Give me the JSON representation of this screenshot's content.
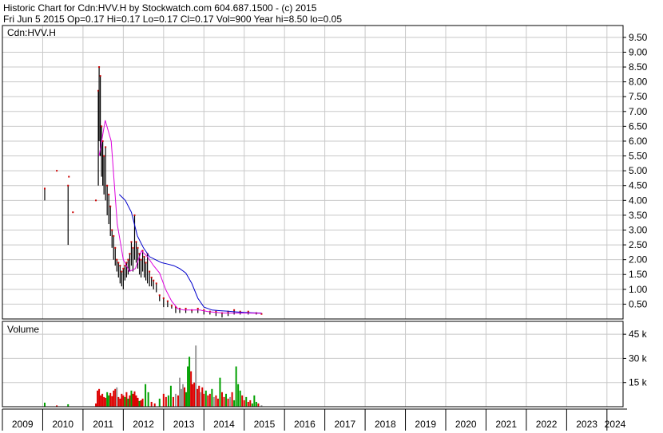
{
  "header": {
    "line1": "Historic Chart for Cdn:HVV.H by Stockwatch.com 604.687.1500 - (c) 2015",
    "line2": "Fri Jun  5 2015  Op=0.17  Hi=0.17  Lo=0.17  Cl=0.17  Vol=900  Year hi=8.50  lo=0.05"
  },
  "chart_data": [
    {
      "type": "line",
      "title": "Cdn:HVV.H",
      "xlim": [
        2009.0,
        2024.4
      ],
      "ylim": [
        0,
        9.9
      ],
      "y_ticks": [
        0.5,
        1.0,
        1.5,
        2.0,
        2.5,
        3.0,
        3.5,
        4.0,
        4.5,
        5.0,
        5.5,
        6.0,
        6.5,
        7.0,
        7.5,
        8.0,
        8.5,
        9.0,
        9.5
      ],
      "y_tick_labels": [
        "0.50",
        "1.00",
        "1.50",
        "2.00",
        "2.50",
        "3.00",
        "3.50",
        "4.00",
        "4.50",
        "5.00",
        "5.50",
        "6.00",
        "6.50",
        "7.00",
        "7.50",
        "8.00",
        "8.50",
        "9.00",
        "9.50"
      ],
      "grid": true,
      "colors": {
        "price": "#000000",
        "close": "#cc0000",
        "ma_short": "#dd00dd",
        "ma_long": "#0000cc"
      },
      "price_bars": [
        {
          "x": 2010.05,
          "hi": 4.4,
          "lo": 4.0
        },
        {
          "x": 2010.35,
          "hi": 5.0,
          "lo": 5.0
        },
        {
          "x": 2010.65,
          "hi": 4.8,
          "lo": 4.8
        },
        {
          "x": 2010.63,
          "hi": 4.5,
          "lo": 2.5
        },
        {
          "x": 2010.75,
          "hi": 3.6,
          "lo": 3.6
        },
        {
          "x": 2011.32,
          "hi": 4.0,
          "lo": 4.0
        },
        {
          "x": 2011.38,
          "hi": 7.7,
          "lo": 4.5
        },
        {
          "x": 2011.4,
          "hi": 8.5,
          "lo": 6.0
        },
        {
          "x": 2011.43,
          "hi": 8.2,
          "lo": 5.5
        },
        {
          "x": 2011.46,
          "hi": 6.5,
          "lo": 4.8
        },
        {
          "x": 2011.49,
          "hi": 6.0,
          "lo": 4.5
        },
        {
          "x": 2011.52,
          "hi": 5.5,
          "lo": 4.2
        },
        {
          "x": 2011.56,
          "hi": 5.8,
          "lo": 4.0
        },
        {
          "x": 2011.6,
          "hi": 4.5,
          "lo": 3.5
        },
        {
          "x": 2011.64,
          "hi": 4.2,
          "lo": 3.2
        },
        {
          "x": 2011.68,
          "hi": 3.8,
          "lo": 2.8
        },
        {
          "x": 2011.72,
          "hi": 3.0,
          "lo": 2.4
        },
        {
          "x": 2011.76,
          "hi": 2.8,
          "lo": 2.0
        },
        {
          "x": 2011.8,
          "hi": 2.4,
          "lo": 1.8
        },
        {
          "x": 2011.84,
          "hi": 2.0,
          "lo": 1.6
        },
        {
          "x": 2011.88,
          "hi": 1.9,
          "lo": 1.4
        },
        {
          "x": 2011.92,
          "hi": 1.8,
          "lo": 1.2
        },
        {
          "x": 2011.96,
          "hi": 1.6,
          "lo": 1.1
        },
        {
          "x": 2012.0,
          "hi": 1.7,
          "lo": 1.0
        },
        {
          "x": 2012.04,
          "hi": 1.8,
          "lo": 1.3
        },
        {
          "x": 2012.08,
          "hi": 1.9,
          "lo": 1.4
        },
        {
          "x": 2012.12,
          "hi": 2.0,
          "lo": 1.5
        },
        {
          "x": 2012.16,
          "hi": 2.2,
          "lo": 1.6
        },
        {
          "x": 2012.2,
          "hi": 2.6,
          "lo": 1.8
        },
        {
          "x": 2012.24,
          "hi": 2.4,
          "lo": 1.6
        },
        {
          "x": 2012.28,
          "hi": 3.5,
          "lo": 2.0
        },
        {
          "x": 2012.32,
          "hi": 2.6,
          "lo": 1.9
        },
        {
          "x": 2012.36,
          "hi": 2.4,
          "lo": 1.7
        },
        {
          "x": 2012.4,
          "hi": 2.2,
          "lo": 1.5
        },
        {
          "x": 2012.44,
          "hi": 2.0,
          "lo": 1.4
        },
        {
          "x": 2012.48,
          "hi": 2.3,
          "lo": 1.6
        },
        {
          "x": 2012.52,
          "hi": 2.1,
          "lo": 1.4
        },
        {
          "x": 2012.56,
          "hi": 1.9,
          "lo": 1.3
        },
        {
          "x": 2012.6,
          "hi": 2.2,
          "lo": 1.2
        },
        {
          "x": 2012.65,
          "hi": 1.6,
          "lo": 1.1
        },
        {
          "x": 2012.7,
          "hi": 1.4,
          "lo": 1.1
        },
        {
          "x": 2012.75,
          "hi": 1.3,
          "lo": 1.0
        },
        {
          "x": 2012.82,
          "hi": 1.2,
          "lo": 0.9
        },
        {
          "x": 2012.9,
          "hi": 0.8,
          "lo": 0.6
        },
        {
          "x": 2013.0,
          "hi": 0.7,
          "lo": 0.4
        },
        {
          "x": 2013.1,
          "hi": 0.6,
          "lo": 0.4
        },
        {
          "x": 2013.2,
          "hi": 0.45,
          "lo": 0.35
        },
        {
          "x": 2013.3,
          "hi": 0.4,
          "lo": 0.2
        },
        {
          "x": 2013.4,
          "hi": 0.35,
          "lo": 0.2
        },
        {
          "x": 2013.55,
          "hi": 0.35,
          "lo": 0.2
        },
        {
          "x": 2013.7,
          "hi": 0.3,
          "lo": 0.2
        },
        {
          "x": 2013.85,
          "hi": 0.35,
          "lo": 0.2
        },
        {
          "x": 2014.0,
          "hi": 0.3,
          "lo": 0.15
        },
        {
          "x": 2014.15,
          "hi": 0.25,
          "lo": 0.15
        },
        {
          "x": 2014.3,
          "hi": 0.25,
          "lo": 0.1
        },
        {
          "x": 2014.45,
          "hi": 0.2,
          "lo": 0.05
        },
        {
          "x": 2014.6,
          "hi": 0.25,
          "lo": 0.1
        },
        {
          "x": 2014.75,
          "hi": 0.3,
          "lo": 0.15
        },
        {
          "x": 2014.9,
          "hi": 0.25,
          "lo": 0.15
        },
        {
          "x": 2015.1,
          "hi": 0.25,
          "lo": 0.15
        },
        {
          "x": 2015.3,
          "hi": 0.2,
          "lo": 0.15
        },
        {
          "x": 2015.43,
          "hi": 0.17,
          "lo": 0.17
        }
      ],
      "ma_short": {
        "x": [
          2011.4,
          2011.55,
          2011.7,
          2011.85,
          2012.0,
          2012.15,
          2012.3,
          2012.45,
          2012.6,
          2012.75,
          2012.9,
          2013.05,
          2013.2,
          2013.35,
          2013.5,
          2013.7,
          2013.9,
          2014.1,
          2014.3,
          2014.5,
          2014.7,
          2014.9,
          2015.1,
          2015.43
        ],
        "y": [
          5.5,
          6.7,
          6.0,
          3.2,
          2.0,
          1.6,
          1.7,
          2.3,
          2.1,
          1.8,
          1.55,
          1.0,
          0.6,
          0.35,
          0.3,
          0.3,
          0.3,
          0.25,
          0.22,
          0.2,
          0.2,
          0.2,
          0.2,
          0.19
        ]
      },
      "ma_long": {
        "x": [
          2011.9,
          2012.05,
          2012.2,
          2012.35,
          2012.5,
          2012.65,
          2012.8,
          2012.95,
          2013.1,
          2013.25,
          2013.4,
          2013.55,
          2013.7,
          2013.85,
          2014.0,
          2014.2,
          2014.4,
          2014.6,
          2014.8,
          2015.0,
          2015.2,
          2015.43
        ],
        "y": [
          4.2,
          4.0,
          3.6,
          2.8,
          2.4,
          2.1,
          2.0,
          1.9,
          1.85,
          1.8,
          1.7,
          1.55,
          1.2,
          0.7,
          0.4,
          0.3,
          0.28,
          0.26,
          0.24,
          0.22,
          0.21,
          0.2
        ]
      }
    },
    {
      "type": "bar",
      "title": "Volume",
      "xlim": [
        2009.0,
        2024.4
      ],
      "ylim": [
        0,
        53000
      ],
      "y_ticks": [
        15000,
        30000,
        45000
      ],
      "y_tick_labels": [
        "15 k",
        "30 k",
        "45 k"
      ],
      "grid": true,
      "colors": {
        "up": "#00a000",
        "down": "#dd0000",
        "flat": "#999999"
      },
      "bars": [
        {
          "x": 2010.05,
          "v": 2500,
          "c": "up"
        },
        {
          "x": 2010.35,
          "v": 800,
          "c": "down"
        },
        {
          "x": 2010.63,
          "v": 1500,
          "c": "up"
        },
        {
          "x": 2011.32,
          "v": 2000,
          "c": "down"
        },
        {
          "x": 2011.36,
          "v": 10000,
          "c": "down"
        },
        {
          "x": 2011.4,
          "v": 11000,
          "c": "down"
        },
        {
          "x": 2011.44,
          "v": 7000,
          "c": "down"
        },
        {
          "x": 2011.48,
          "v": 8000,
          "c": "down"
        },
        {
          "x": 2011.52,
          "v": 6000,
          "c": "down"
        },
        {
          "x": 2011.56,
          "v": 5500,
          "c": "down"
        },
        {
          "x": 2011.6,
          "v": 9000,
          "c": "up"
        },
        {
          "x": 2011.64,
          "v": 7000,
          "c": "up"
        },
        {
          "x": 2011.68,
          "v": 8500,
          "c": "down"
        },
        {
          "x": 2011.72,
          "v": 6500,
          "c": "down"
        },
        {
          "x": 2011.76,
          "v": 10000,
          "c": "down"
        },
        {
          "x": 2011.8,
          "v": 11000,
          "c": "down"
        },
        {
          "x": 2011.84,
          "v": 12000,
          "c": "flat"
        },
        {
          "x": 2011.88,
          "v": 6000,
          "c": "down"
        },
        {
          "x": 2011.92,
          "v": 5000,
          "c": "down"
        },
        {
          "x": 2011.96,
          "v": 8000,
          "c": "down"
        },
        {
          "x": 2012.0,
          "v": 7000,
          "c": "down"
        },
        {
          "x": 2012.04,
          "v": 6000,
          "c": "up"
        },
        {
          "x": 2012.08,
          "v": 9000,
          "c": "down"
        },
        {
          "x": 2012.12,
          "v": 5000,
          "c": "up"
        },
        {
          "x": 2012.16,
          "v": 7000,
          "c": "down"
        },
        {
          "x": 2012.2,
          "v": 10000,
          "c": "up"
        },
        {
          "x": 2012.24,
          "v": 8000,
          "c": "down"
        },
        {
          "x": 2012.28,
          "v": 9500,
          "c": "down"
        },
        {
          "x": 2012.32,
          "v": 7000,
          "c": "down"
        },
        {
          "x": 2012.36,
          "v": 5500,
          "c": "down"
        },
        {
          "x": 2012.4,
          "v": 3500,
          "c": "up"
        },
        {
          "x": 2012.44,
          "v": 4000,
          "c": "down"
        },
        {
          "x": 2012.48,
          "v": 5000,
          "c": "down"
        },
        {
          "x": 2012.55,
          "v": 14000,
          "c": "up"
        },
        {
          "x": 2012.62,
          "v": 9000,
          "c": "up"
        },
        {
          "x": 2012.7,
          "v": 3000,
          "c": "down"
        },
        {
          "x": 2012.78,
          "v": 2000,
          "c": "down"
        },
        {
          "x": 2012.9,
          "v": 5000,
          "c": "up"
        },
        {
          "x": 2013.0,
          "v": 8000,
          "c": "down"
        },
        {
          "x": 2013.06,
          "v": 6000,
          "c": "down"
        },
        {
          "x": 2013.12,
          "v": 7000,
          "c": "up"
        },
        {
          "x": 2013.18,
          "v": 13000,
          "c": "up"
        },
        {
          "x": 2013.24,
          "v": 6000,
          "c": "down"
        },
        {
          "x": 2013.3,
          "v": 8000,
          "c": "flat"
        },
        {
          "x": 2013.36,
          "v": 7000,
          "c": "down"
        },
        {
          "x": 2013.4,
          "v": 18000,
          "c": "flat"
        },
        {
          "x": 2013.44,
          "v": 11000,
          "c": "flat"
        },
        {
          "x": 2013.48,
          "v": 14000,
          "c": "flat"
        },
        {
          "x": 2013.52,
          "v": 12000,
          "c": "down"
        },
        {
          "x": 2013.56,
          "v": 9000,
          "c": "up"
        },
        {
          "x": 2013.6,
          "v": 25000,
          "c": "up"
        },
        {
          "x": 2013.64,
          "v": 31000,
          "c": "up"
        },
        {
          "x": 2013.68,
          "v": 22000,
          "c": "down"
        },
        {
          "x": 2013.72,
          "v": 14000,
          "c": "down"
        },
        {
          "x": 2013.76,
          "v": 15000,
          "c": "down"
        },
        {
          "x": 2013.8,
          "v": 38000,
          "c": "flat"
        },
        {
          "x": 2013.84,
          "v": 11000,
          "c": "down"
        },
        {
          "x": 2013.88,
          "v": 13000,
          "c": "down"
        },
        {
          "x": 2013.92,
          "v": 9000,
          "c": "flat"
        },
        {
          "x": 2013.96,
          "v": 12000,
          "c": "down"
        },
        {
          "x": 2014.0,
          "v": 8000,
          "c": "down"
        },
        {
          "x": 2014.05,
          "v": 10000,
          "c": "up"
        },
        {
          "x": 2014.1,
          "v": 7000,
          "c": "down"
        },
        {
          "x": 2014.15,
          "v": 8000,
          "c": "down"
        },
        {
          "x": 2014.2,
          "v": 11000,
          "c": "up"
        },
        {
          "x": 2014.25,
          "v": 6000,
          "c": "flat"
        },
        {
          "x": 2014.3,
          "v": 7000,
          "c": "down"
        },
        {
          "x": 2014.35,
          "v": 5000,
          "c": "down"
        },
        {
          "x": 2014.4,
          "v": 18000,
          "c": "up"
        },
        {
          "x": 2014.45,
          "v": 9000,
          "c": "down"
        },
        {
          "x": 2014.5,
          "v": 6000,
          "c": "down"
        },
        {
          "x": 2014.55,
          "v": 8000,
          "c": "up"
        },
        {
          "x": 2014.6,
          "v": 5000,
          "c": "down"
        },
        {
          "x": 2014.65,
          "v": 6000,
          "c": "flat"
        },
        {
          "x": 2014.7,
          "v": 9000,
          "c": "down"
        },
        {
          "x": 2014.75,
          "v": 4000,
          "c": "up"
        },
        {
          "x": 2014.8,
          "v": 25000,
          "c": "up"
        },
        {
          "x": 2014.85,
          "v": 14000,
          "c": "up"
        },
        {
          "x": 2014.9,
          "v": 10000,
          "c": "up"
        },
        {
          "x": 2014.95,
          "v": 7000,
          "c": "down"
        },
        {
          "x": 2015.0,
          "v": 4000,
          "c": "down"
        },
        {
          "x": 2015.05,
          "v": 6000,
          "c": "up"
        },
        {
          "x": 2015.1,
          "v": 3000,
          "c": "down"
        },
        {
          "x": 2015.15,
          "v": 4000,
          "c": "down"
        },
        {
          "x": 2015.2,
          "v": 2000,
          "c": "up"
        },
        {
          "x": 2015.25,
          "v": 7000,
          "c": "up"
        },
        {
          "x": 2015.3,
          "v": 3000,
          "c": "up"
        },
        {
          "x": 2015.35,
          "v": 2000,
          "c": "down"
        },
        {
          "x": 2015.43,
          "v": 900,
          "c": "flat"
        }
      ]
    }
  ],
  "x_axis": {
    "labels": [
      "2009",
      "2010",
      "2011",
      "2012",
      "2013",
      "2014",
      "2015",
      "2016",
      "2017",
      "2018",
      "2019",
      "2020",
      "2021",
      "2022",
      "2023",
      "2024"
    ],
    "values": [
      2009,
      2010,
      2011,
      2012,
      2013,
      2014,
      2015,
      2016,
      2017,
      2018,
      2019,
      2020,
      2021,
      2022,
      2023,
      2024
    ]
  }
}
